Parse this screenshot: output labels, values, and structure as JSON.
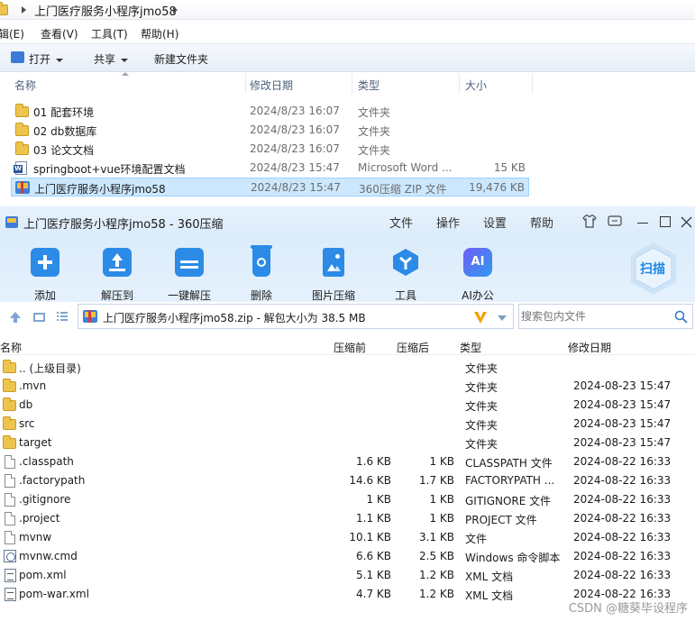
{
  "explorer": {
    "breadcrumb": "上门医疗服务小程序jmo58",
    "menu": [
      "辑(E)",
      "查看(V)",
      "工具(T)",
      "帮助(H)"
    ],
    "commands": {
      "open": "打开",
      "share": "共享",
      "new_folder": "新建文件夹"
    },
    "columns": {
      "name": "名称",
      "date": "修改日期",
      "type": "类型",
      "size": "大小"
    },
    "files": [
      {
        "name": "01 配套环境",
        "date": "2024/8/23 16:07",
        "type": "文件夹",
        "size": "",
        "icon": "folder-icon"
      },
      {
        "name": "02 db数据库",
        "date": "2024/8/23 16:07",
        "type": "文件夹",
        "size": "",
        "icon": "folder-icon"
      },
      {
        "name": "03 论文文档",
        "date": "2024/8/23 16:07",
        "type": "文件夹",
        "size": "",
        "icon": "folder-icon"
      },
      {
        "name": "springboot+vue环境配置文档",
        "date": "2024/8/23 15:47",
        "type": "Microsoft Word ...",
        "size": "15 KB",
        "icon": "word-document-icon"
      },
      {
        "name": "上门医疗服务小程序jmo58",
        "date": "2024/8/23 15:47",
        "type": "360压缩 ZIP 文件",
        "size": "19,476 KB",
        "icon": "zip-archive-icon",
        "selected": true
      }
    ]
  },
  "zip": {
    "title": "上门医疗服务小程序jmo58 - 360压缩",
    "menu": [
      "文件",
      "操作",
      "设置",
      "帮助"
    ],
    "toolbar": [
      "添加",
      "解压到",
      "一键解压",
      "删除",
      "图片压缩",
      "工具",
      "AI办公"
    ],
    "scan_label": "扫描",
    "ai_badge": "AI",
    "path": "上门医疗服务小程序jmo58.zip - 解包大小为 38.5 MB",
    "search_placeholder": "搜索包内文件",
    "columns": {
      "name": "名称",
      "before": "压缩前",
      "after": "压缩后",
      "type": "类型",
      "date": "修改日期"
    },
    "entries": [
      {
        "name": ".. (上级目录)",
        "before": "",
        "after": "",
        "type": "文件夹",
        "date": "",
        "icon": "folder-icon"
      },
      {
        "name": ".mvn",
        "before": "",
        "after": "",
        "type": "文件夹",
        "date": "2024-08-23 15:47",
        "icon": "folder-icon"
      },
      {
        "name": "db",
        "before": "",
        "after": "",
        "type": "文件夹",
        "date": "2024-08-23 15:47",
        "icon": "folder-icon"
      },
      {
        "name": "src",
        "before": "",
        "after": "",
        "type": "文件夹",
        "date": "2024-08-23 15:47",
        "icon": "folder-icon"
      },
      {
        "name": "target",
        "before": "",
        "after": "",
        "type": "文件夹",
        "date": "2024-08-23 15:47",
        "icon": "folder-icon"
      },
      {
        "name": ".classpath",
        "before": "1.6 KB",
        "after": "1 KB",
        "type": "CLASSPATH 文件",
        "date": "2024-08-22 16:33",
        "icon": "file-icon"
      },
      {
        "name": ".factorypath",
        "before": "14.6 KB",
        "after": "1.7 KB",
        "type": "FACTORYPATH ...",
        "date": "2024-08-22 16:33",
        "icon": "file-icon"
      },
      {
        "name": ".gitignore",
        "before": "1 KB",
        "after": "1 KB",
        "type": "GITIGNORE 文件",
        "date": "2024-08-22 16:33",
        "icon": "file-icon"
      },
      {
        "name": ".project",
        "before": "1.1 KB",
        "after": "1 KB",
        "type": "PROJECT 文件",
        "date": "2024-08-22 16:33",
        "icon": "file-icon"
      },
      {
        "name": "mvnw",
        "before": "10.1 KB",
        "after": "3.1 KB",
        "type": "文件",
        "date": "2024-08-22 16:33",
        "icon": "file-icon"
      },
      {
        "name": "mvnw.cmd",
        "before": "6.6 KB",
        "after": "2.5 KB",
        "type": "Windows 命令脚本",
        "date": "2024-08-22 16:33",
        "icon": "cmd-script-icon"
      },
      {
        "name": "pom.xml",
        "before": "5.1 KB",
        "after": "1.2 KB",
        "type": "XML 文档",
        "date": "2024-08-22 16:33",
        "icon": "xml-file-icon"
      },
      {
        "name": "pom-war.xml",
        "before": "4.7 KB",
        "after": "1.2 KB",
        "type": "XML 文档",
        "date": "2024-08-22 16:33",
        "icon": "xml-file-icon"
      }
    ]
  },
  "watermark": "CSDN @糖葵毕设程序",
  "colors": {
    "accent": "#1e88e5",
    "selection": "#cce8ff",
    "toolbar_bg": "#dcecfb"
  }
}
